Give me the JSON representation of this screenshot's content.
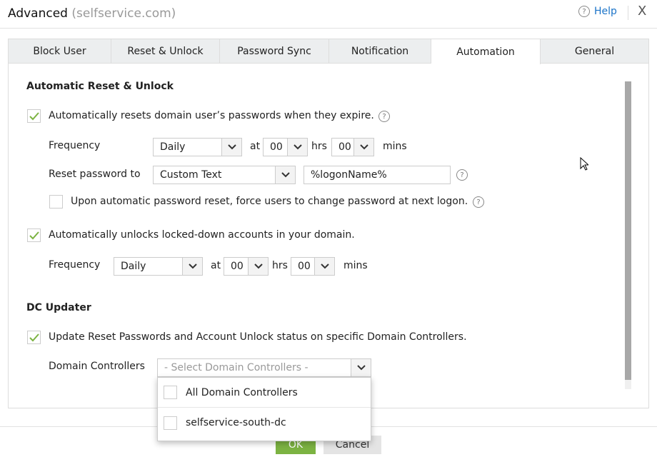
{
  "header": {
    "title": "Advanced",
    "domain": "(selfservice.com)",
    "help": "Help",
    "close": "X"
  },
  "tabs": [
    {
      "label": "Block User"
    },
    {
      "label": "Reset & Unlock"
    },
    {
      "label": "Password Sync"
    },
    {
      "label": "Notification"
    },
    {
      "label": "Automation",
      "active": true
    },
    {
      "label": "General"
    }
  ],
  "reset": {
    "heading": "Automatic Reset & Unlock",
    "auto_reset_label": "Automatically resets domain user’s passwords when they expire.",
    "auto_reset_checked": true,
    "frequency_label": "Frequency",
    "frequency": "Daily",
    "at": "at",
    "hrs_value": "00",
    "hrs": "hrs",
    "mins_value": "00",
    "mins": "mins",
    "reset_to_label": "Reset password to",
    "reset_to": "Custom Text",
    "custom_text": "%logonName%",
    "force_change_label": "Upon automatic password reset, force users to change password at next logon.",
    "force_change_checked": false,
    "auto_unlock_label": "Automatically unlocks locked-down accounts in your domain.",
    "auto_unlock_checked": true,
    "unlock_frequency": "Daily",
    "unlock_hrs": "00",
    "unlock_mins": "00"
  },
  "dc": {
    "heading": "DC Updater",
    "update_label": "Update Reset Passwords and Account Unlock status on specific Domain Controllers.",
    "update_checked": true,
    "controllers_label": "Domain Controllers",
    "placeholder": "- Select Domain Controllers -",
    "options": [
      {
        "label": "All Domain Controllers"
      },
      {
        "label": "selfservice-south-dc"
      }
    ]
  },
  "footer": {
    "ok": "OK",
    "cancel": "Cancel"
  },
  "colors": {
    "accent": "#7cb342",
    "link": "#1a73c8",
    "check": "#7cb342"
  }
}
